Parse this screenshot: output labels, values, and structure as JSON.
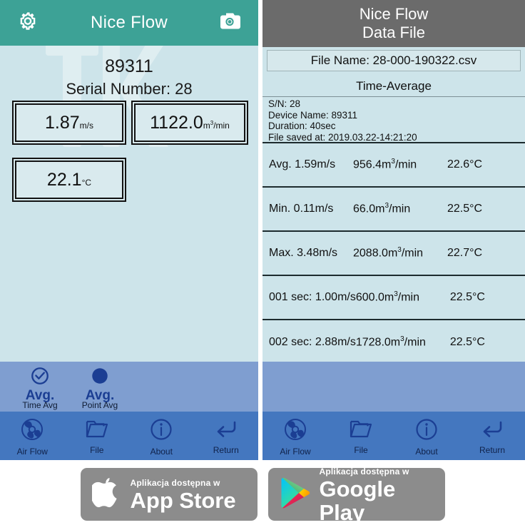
{
  "left_panel": {
    "header": {
      "title": "Nice Flow",
      "settings_icon": "gear-icon",
      "camera_icon": "camera-icon"
    },
    "device_name": "89311",
    "serial_label": "Serial Number: 28",
    "readouts": [
      {
        "name": "air-speed",
        "value": "1.87",
        "unit": "m/s"
      },
      {
        "name": "volume-flow",
        "value": "1122.0",
        "unit_pre": "m",
        "unit_sup": "3",
        "unit_post": "/min"
      },
      {
        "name": "temperature",
        "value": "22.1",
        "unit": "°C"
      }
    ],
    "avg_modes": [
      {
        "big": "Avg.",
        "sub": "Time Avg",
        "icon": "check-circle-icon",
        "selected": false
      },
      {
        "big": "Avg.",
        "sub": "Point Avg",
        "icon": "filled-circle-icon",
        "selected": true
      }
    ],
    "nav": [
      {
        "label": "Air Flow",
        "icon": "fan-icon"
      },
      {
        "label": "File",
        "icon": "folder-icon"
      },
      {
        "label": "About",
        "icon": "info-icon"
      },
      {
        "label": "Return",
        "icon": "return-arrow-icon"
      }
    ]
  },
  "right_panel": {
    "header": {
      "line1": "Nice Flow",
      "line2": "Data File"
    },
    "file_name": "File Name: 28-000-190322.csv",
    "section_title": "Time-Average",
    "meta": [
      "S/N: 28",
      "Device Name: 89311",
      "Duration: 40sec",
      "File saved at: 2019.03.22-14:21:20"
    ],
    "rows": [
      {
        "label": "Avg. 1.59m/s",
        "flow": "956.4",
        "flow_unit_pre": "m",
        "flow_sup": "3",
        "flow_unit_post": "/min",
        "temp": "22.6°C"
      },
      {
        "label": "Min. 0.11m/s",
        "flow": "66.0",
        "flow_unit_pre": "m",
        "flow_sup": "3",
        "flow_unit_post": "/min",
        "temp": "22.5°C"
      },
      {
        "label": "Max. 3.48m/s",
        "flow": "2088.0",
        "flow_unit_pre": "m",
        "flow_sup": "3",
        "flow_unit_post": "/min",
        "temp": "22.7°C"
      },
      {
        "label": "001 sec: 1.00m/s",
        "flow": "600.0",
        "flow_unit_pre": "m",
        "flow_sup": "3",
        "flow_unit_post": "/min",
        "temp": "22.5°C"
      },
      {
        "label": "002 sec: 2.88m/s",
        "flow": "1728.0",
        "flow_unit_pre": "m",
        "flow_sup": "3",
        "flow_unit_post": "/min",
        "temp": "22.5°C"
      }
    ],
    "nav": [
      {
        "label": "Air Flow",
        "icon": "fan-icon"
      },
      {
        "label": "File",
        "icon": "folder-icon"
      },
      {
        "label": "About",
        "icon": "info-icon"
      },
      {
        "label": "Return",
        "icon": "return-arrow-icon"
      }
    ]
  },
  "badges": [
    {
      "name": "app-store-badge",
      "small": "Aplikacja dostępna w",
      "big": "App Store",
      "icon": "apple-logo-icon"
    },
    {
      "name": "google-play-badge",
      "small": "Aplikacja dostępna w",
      "big": "Google Play",
      "icon": "google-play-logo-icon"
    }
  ],
  "colors": {
    "teal_header": "#3da296",
    "panel_bg": "#cde4ea",
    "gray_header": "#6b6b6b",
    "nav_blue": "#4477bf",
    "avg_blue": "#7f9ed0",
    "icon_blue": "#1b3e93",
    "badge_gray": "#8c8c8c"
  }
}
